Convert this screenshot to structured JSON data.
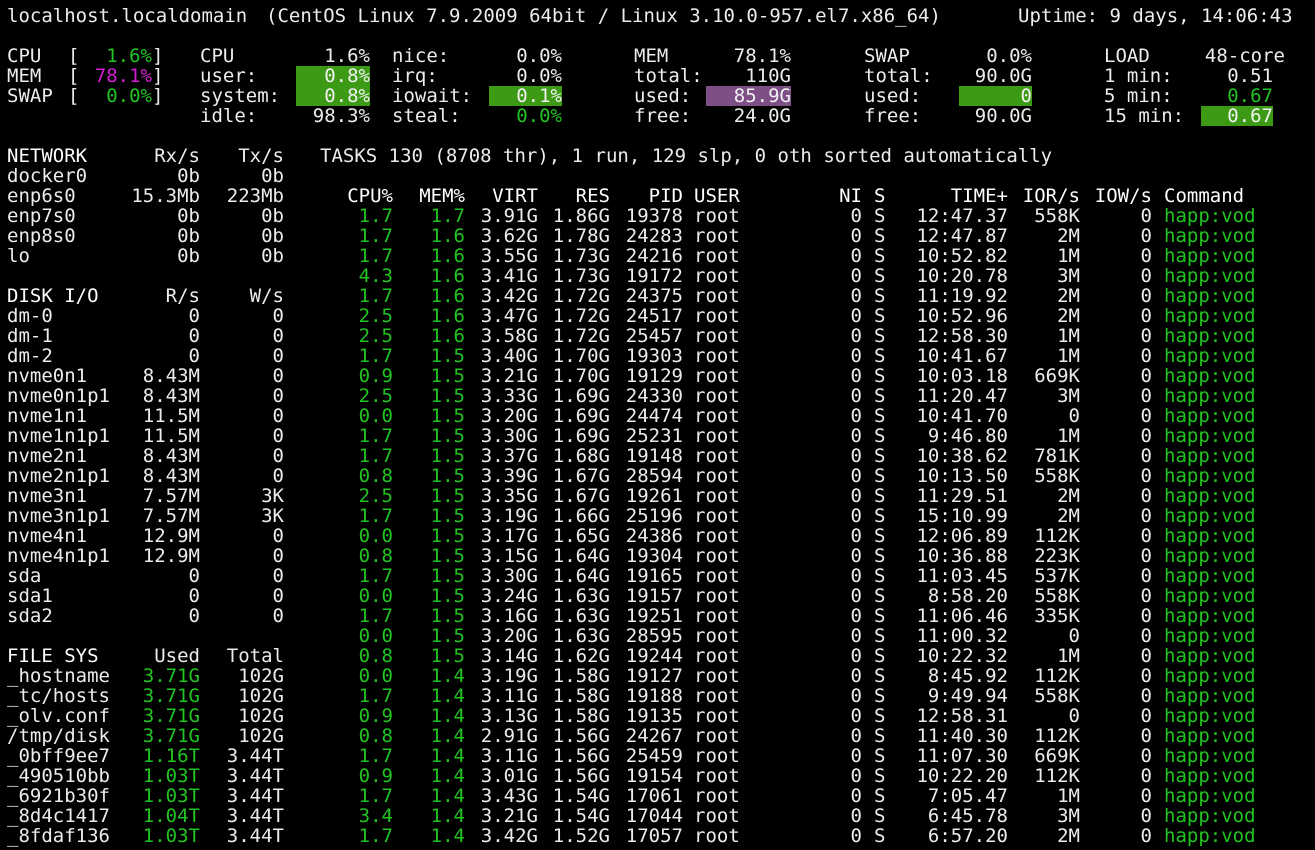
{
  "header": {
    "host": "localhost.localdomain",
    "system": "(CentOS Linux 7.9.2009 64bit / Linux 3.10.0-957.el7.x86_64)",
    "uptime": "Uptime: 9 days, 14:06:43"
  },
  "quicklook": [
    {
      "label": "CPU",
      "value": "1.6%"
    },
    {
      "label": "MEM",
      "value": "78.1%"
    },
    {
      "label": "SWAP",
      "value": "0.0%"
    }
  ],
  "cpu": {
    "title": "CPU",
    "total": "1.6%",
    "rows": [
      {
        "k": "user:",
        "v": "0.8%",
        "k2": "irq:",
        "v2": "0.0%"
      },
      {
        "k": "system:",
        "v": "0.8%",
        "k2": "iowait:",
        "v2": "0.1%"
      },
      {
        "k": "idle:",
        "v": "98.3%",
        "k2": "steal:",
        "v2": "0.0%"
      }
    ],
    "nice_label": "nice:",
    "nice": "0.0%"
  },
  "mem": {
    "title": "MEM",
    "percent": "78.1%",
    "rows": [
      {
        "k": "total:",
        "v": "110G"
      },
      {
        "k": "used:",
        "v": "85.9G"
      },
      {
        "k": "free:",
        "v": "24.0G"
      }
    ]
  },
  "swap": {
    "title": "SWAP",
    "percent": "0.0%",
    "rows": [
      {
        "k": "total:",
        "v": "90.0G"
      },
      {
        "k": "used:",
        "v": "0"
      },
      {
        "k": "free:",
        "v": "90.0G"
      }
    ]
  },
  "load": {
    "title": "LOAD",
    "cores": "48-core",
    "rows": [
      {
        "k": "1 min:",
        "v": "0.51"
      },
      {
        "k": "5 min:",
        "v": "0.67"
      },
      {
        "k": "15 min:",
        "v": "0.67"
      }
    ]
  },
  "network": {
    "headers": [
      "NETWORK",
      "Rx/s",
      "Tx/s"
    ],
    "rows": [
      [
        "docker0",
        "0b",
        "0b"
      ],
      [
        "enp6s0",
        "15.3Mb",
        "223Mb"
      ],
      [
        "enp7s0",
        "0b",
        "0b"
      ],
      [
        "enp8s0",
        "0b",
        "0b"
      ],
      [
        "lo",
        "0b",
        "0b"
      ]
    ]
  },
  "diskio": {
    "headers": [
      "DISK I/O",
      "R/s",
      "W/s"
    ],
    "rows": [
      [
        "dm-0",
        "0",
        "0"
      ],
      [
        "dm-1",
        "0",
        "0"
      ],
      [
        "dm-2",
        "0",
        "0"
      ],
      [
        "nvme0n1",
        "8.43M",
        "0"
      ],
      [
        "nvme0n1p1",
        "8.43M",
        "0"
      ],
      [
        "nvme1n1",
        "11.5M",
        "0"
      ],
      [
        "nvme1n1p1",
        "11.5M",
        "0"
      ],
      [
        "nvme2n1",
        "8.43M",
        "0"
      ],
      [
        "nvme2n1p1",
        "8.43M",
        "0"
      ],
      [
        "nvme3n1",
        "7.57M",
        "3K"
      ],
      [
        "nvme3n1p1",
        "7.57M",
        "3K"
      ],
      [
        "nvme4n1",
        "12.9M",
        "0"
      ],
      [
        "nvme4n1p1",
        "12.9M",
        "0"
      ],
      [
        "sda",
        "0",
        "0"
      ],
      [
        "sda1",
        "0",
        "0"
      ],
      [
        "sda2",
        "0",
        "0"
      ]
    ]
  },
  "filesys": {
    "headers": [
      "FILE SYS",
      "Used",
      "Total"
    ],
    "rows": [
      [
        "_hostname",
        "3.71G",
        "102G"
      ],
      [
        "_tc/hosts",
        "3.71G",
        "102G"
      ],
      [
        "_olv.conf",
        "3.71G",
        "102G"
      ],
      [
        "/tmp/disk",
        "3.71G",
        "102G"
      ],
      [
        "_0bff9ee7",
        "1.16T",
        "3.44T"
      ],
      [
        "_490510bb",
        "1.03T",
        "3.44T"
      ],
      [
        "_6921b30f",
        "1.03T",
        "3.44T"
      ],
      [
        "_8d4c1417",
        "1.04T",
        "3.44T"
      ],
      [
        "_8fdaf136",
        "1.03T",
        "3.44T"
      ]
    ]
  },
  "tasks": {
    "summary": "TASKS 130 (8708 thr), 1 run, 129 slp, 0 oth sorted automatically",
    "headers": [
      "CPU%",
      "MEM%",
      "VIRT",
      "RES",
      "PID",
      "USER",
      "NI",
      "S",
      "TIME+",
      "IOR/s",
      "IOW/s",
      "Command"
    ],
    "rows": [
      [
        "1.7",
        "1.7",
        "3.91G",
        "1.86G",
        "19378",
        "root",
        "0",
        "S",
        "12:47.37",
        "558K",
        "0",
        "happ:vod"
      ],
      [
        "1.7",
        "1.6",
        "3.62G",
        "1.78G",
        "24283",
        "root",
        "0",
        "S",
        "12:47.87",
        "2M",
        "0",
        "happ:vod"
      ],
      [
        "1.7",
        "1.6",
        "3.55G",
        "1.73G",
        "24216",
        "root",
        "0",
        "S",
        "10:52.82",
        "1M",
        "0",
        "happ:vod"
      ],
      [
        "4.3",
        "1.6",
        "3.41G",
        "1.73G",
        "19172",
        "root",
        "0",
        "S",
        "10:20.78",
        "3M",
        "0",
        "happ:vod"
      ],
      [
        "1.7",
        "1.6",
        "3.42G",
        "1.72G",
        "24375",
        "root",
        "0",
        "S",
        "11:19.92",
        "2M",
        "0",
        "happ:vod"
      ],
      [
        "2.5",
        "1.6",
        "3.47G",
        "1.72G",
        "24517",
        "root",
        "0",
        "S",
        "10:52.96",
        "2M",
        "0",
        "happ:vod"
      ],
      [
        "2.5",
        "1.6",
        "3.58G",
        "1.72G",
        "25457",
        "root",
        "0",
        "S",
        "12:58.30",
        "1M",
        "0",
        "happ:vod"
      ],
      [
        "1.7",
        "1.5",
        "3.40G",
        "1.70G",
        "19303",
        "root",
        "0",
        "S",
        "10:41.67",
        "1M",
        "0",
        "happ:vod"
      ],
      [
        "0.9",
        "1.5",
        "3.21G",
        "1.70G",
        "19129",
        "root",
        "0",
        "S",
        "10:03.18",
        "669K",
        "0",
        "happ:vod"
      ],
      [
        "2.5",
        "1.5",
        "3.33G",
        "1.69G",
        "24330",
        "root",
        "0",
        "S",
        "11:20.47",
        "3M",
        "0",
        "happ:vod"
      ],
      [
        "0.0",
        "1.5",
        "3.20G",
        "1.69G",
        "24474",
        "root",
        "0",
        "S",
        "10:41.70",
        "0",
        "0",
        "happ:vod"
      ],
      [
        "1.7",
        "1.5",
        "3.30G",
        "1.69G",
        "25231",
        "root",
        "0",
        "S",
        "9:46.80",
        "1M",
        "0",
        "happ:vod"
      ],
      [
        "1.7",
        "1.5",
        "3.37G",
        "1.68G",
        "19148",
        "root",
        "0",
        "S",
        "10:38.62",
        "781K",
        "0",
        "happ:vod"
      ],
      [
        "0.8",
        "1.5",
        "3.39G",
        "1.67G",
        "28594",
        "root",
        "0",
        "S",
        "10:13.50",
        "558K",
        "0",
        "happ:vod"
      ],
      [
        "2.5",
        "1.5",
        "3.35G",
        "1.67G",
        "19261",
        "root",
        "0",
        "S",
        "11:29.51",
        "2M",
        "0",
        "happ:vod"
      ],
      [
        "1.7",
        "1.5",
        "3.19G",
        "1.66G",
        "25196",
        "root",
        "0",
        "S",
        "15:10.99",
        "2M",
        "0",
        "happ:vod"
      ],
      [
        "0.0",
        "1.5",
        "3.17G",
        "1.65G",
        "24386",
        "root",
        "0",
        "S",
        "12:06.89",
        "112K",
        "0",
        "happ:vod"
      ],
      [
        "0.8",
        "1.5",
        "3.15G",
        "1.64G",
        "19304",
        "root",
        "0",
        "S",
        "10:36.88",
        "223K",
        "0",
        "happ:vod"
      ],
      [
        "1.7",
        "1.5",
        "3.30G",
        "1.64G",
        "19165",
        "root",
        "0",
        "S",
        "11:03.45",
        "537K",
        "0",
        "happ:vod"
      ],
      [
        "0.0",
        "1.5",
        "3.24G",
        "1.63G",
        "19157",
        "root",
        "0",
        "S",
        "8:58.20",
        "558K",
        "0",
        "happ:vod"
      ],
      [
        "1.7",
        "1.5",
        "3.16G",
        "1.63G",
        "19251",
        "root",
        "0",
        "S",
        "11:06.46",
        "335K",
        "0",
        "happ:vod"
      ],
      [
        "0.0",
        "1.5",
        "3.20G",
        "1.63G",
        "28595",
        "root",
        "0",
        "S",
        "11:00.32",
        "0",
        "0",
        "happ:vod"
      ],
      [
        "0.8",
        "1.5",
        "3.14G",
        "1.62G",
        "19244",
        "root",
        "0",
        "S",
        "10:22.32",
        "1M",
        "0",
        "happ:vod"
      ],
      [
        "0.0",
        "1.4",
        "3.19G",
        "1.58G",
        "19127",
        "root",
        "0",
        "S",
        "8:45.92",
        "112K",
        "0",
        "happ:vod"
      ],
      [
        "1.7",
        "1.4",
        "3.11G",
        "1.58G",
        "19188",
        "root",
        "0",
        "S",
        "9:49.94",
        "558K",
        "0",
        "happ:vod"
      ],
      [
        "0.9",
        "1.4",
        "3.13G",
        "1.58G",
        "19135",
        "root",
        "0",
        "S",
        "12:58.31",
        "0",
        "0",
        "happ:vod"
      ],
      [
        "0.8",
        "1.4",
        "2.91G",
        "1.56G",
        "24267",
        "root",
        "0",
        "S",
        "11:40.30",
        "112K",
        "0",
        "happ:vod"
      ],
      [
        "1.7",
        "1.4",
        "3.11G",
        "1.56G",
        "25459",
        "root",
        "0",
        "S",
        "11:07.30",
        "669K",
        "0",
        "happ:vod"
      ],
      [
        "0.9",
        "1.4",
        "3.01G",
        "1.56G",
        "19154",
        "root",
        "0",
        "S",
        "10:22.20",
        "112K",
        "0",
        "happ:vod"
      ],
      [
        "1.7",
        "1.4",
        "3.43G",
        "1.54G",
        "17061",
        "root",
        "0",
        "S",
        "7:05.47",
        "1M",
        "0",
        "happ:vod"
      ],
      [
        "3.4",
        "1.4",
        "3.21G",
        "1.54G",
        "17044",
        "root",
        "0",
        "S",
        "6:45.78",
        "3M",
        "0",
        "happ:vod"
      ],
      [
        "1.7",
        "1.4",
        "3.42G",
        "1.52G",
        "17057",
        "root",
        "0",
        "S",
        "6:57.20",
        "2M",
        "0",
        "happ:vod"
      ]
    ]
  },
  "colors": {
    "green": "#22c422",
    "magenta": "#d21fd2",
    "bar_green": "#3c9a14",
    "bar_purple": "#7e4f86"
  }
}
